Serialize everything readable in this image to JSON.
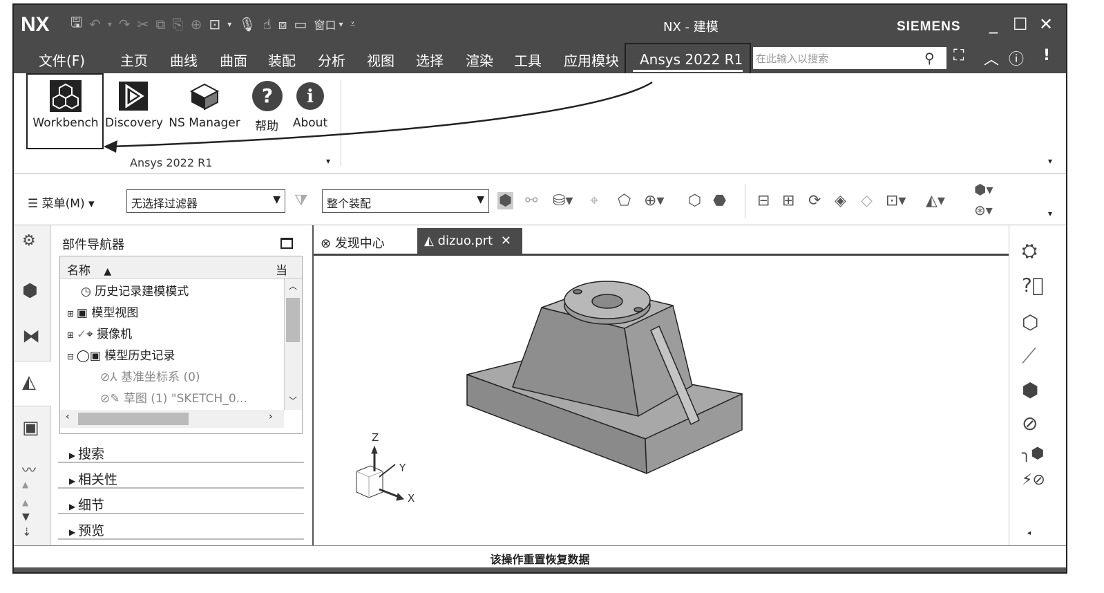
{
  "app": {
    "logo": "NX",
    "window_title": "NX - 建模",
    "brand": "SIEMENS"
  },
  "menu": {
    "items": [
      "文件(F)",
      "主页",
      "曲线",
      "曲面",
      "装配",
      "分析",
      "视图",
      "选择",
      "渲染",
      "工具",
      "应用模块"
    ],
    "active_tab": "Ansys 2022 R1",
    "search_placeholder": "在此输入以搜索",
    "qat_window": "窗口"
  },
  "ribbon": {
    "buttons": [
      "Workbench",
      "Discovery",
      "NS Manager",
      "帮助",
      "About"
    ],
    "group_label": "Ansys 2022 R1"
  },
  "toolbar": {
    "menu_label": "菜单(M)",
    "filter_value": "无选择过滤器",
    "scope_value": "整个装配"
  },
  "navigator": {
    "title": "部件导航器",
    "col_name": "名称",
    "col_current": "当",
    "rows": [
      "历史记录建模模式",
      "模型视图",
      "摄像机",
      "模型历史记录",
      "基准坐标系 (0)",
      "草图 (1) \"SKETCH_0..."
    ],
    "sections": [
      "搜索",
      "相关性",
      "细节",
      "预览"
    ]
  },
  "tabs": {
    "discovery": "发现中心",
    "file": "dizuo.prt"
  },
  "triad": {
    "z": "Z",
    "y": "Y",
    "x": "X"
  },
  "status": "该操作重置恢复数据",
  "colors": {
    "chrome": "#4a4a4a",
    "model": "#8c8c8c"
  }
}
